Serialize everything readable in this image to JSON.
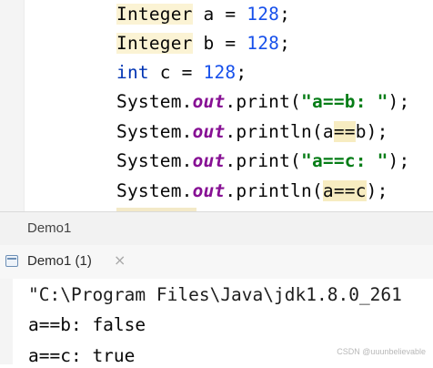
{
  "editor": {
    "lines": [
      [
        {
          "t": "Integer",
          "c": "hl"
        },
        {
          "t": " a = "
        },
        {
          "t": "128",
          "c": "num"
        },
        {
          "t": ";"
        }
      ],
      [
        {
          "t": "Integer",
          "c": "hl"
        },
        {
          "t": " b = "
        },
        {
          "t": "128",
          "c": "num"
        },
        {
          "t": ";"
        }
      ],
      [
        {
          "t": "int",
          "c": "kw"
        },
        {
          "t": " c = "
        },
        {
          "t": "128",
          "c": "num"
        },
        {
          "t": ";"
        }
      ],
      [
        {
          "t": "System."
        },
        {
          "t": "out",
          "c": "fld"
        },
        {
          "t": ".print("
        },
        {
          "t": "\"a==b: \"",
          "c": "str"
        },
        {
          "t": ");"
        }
      ],
      [
        {
          "t": "System."
        },
        {
          "t": "out",
          "c": "fld"
        },
        {
          "t": ".println(a"
        },
        {
          "t": "==",
          "c": "hl2"
        },
        {
          "t": "b);"
        }
      ],
      [
        {
          "t": "System."
        },
        {
          "t": "out",
          "c": "fld"
        },
        {
          "t": ".print("
        },
        {
          "t": "\"a==c: \"",
          "c": "str"
        },
        {
          "t": ");"
        }
      ],
      [
        {
          "t": "System."
        },
        {
          "t": "out",
          "c": "fld"
        },
        {
          "t": ".println("
        },
        {
          "t": "a==c",
          "c": "hl2"
        },
        {
          "t": ");"
        }
      ]
    ]
  },
  "run_panel": {
    "title": "Demo1",
    "tab_label": "Demo1 (1)",
    "tab_close": "×",
    "console_lines": [
      "\"C:\\Program Files\\Java\\jdk1.8.0_261",
      "a==b: false",
      "a==c: true"
    ]
  },
  "watermark": "CSDN @uuunbelievable",
  "colors": {
    "keyword": "#0033b3",
    "number": "#1750eb",
    "string": "#067d17",
    "field": "#871094",
    "highlight": "#fbf3d4"
  }
}
